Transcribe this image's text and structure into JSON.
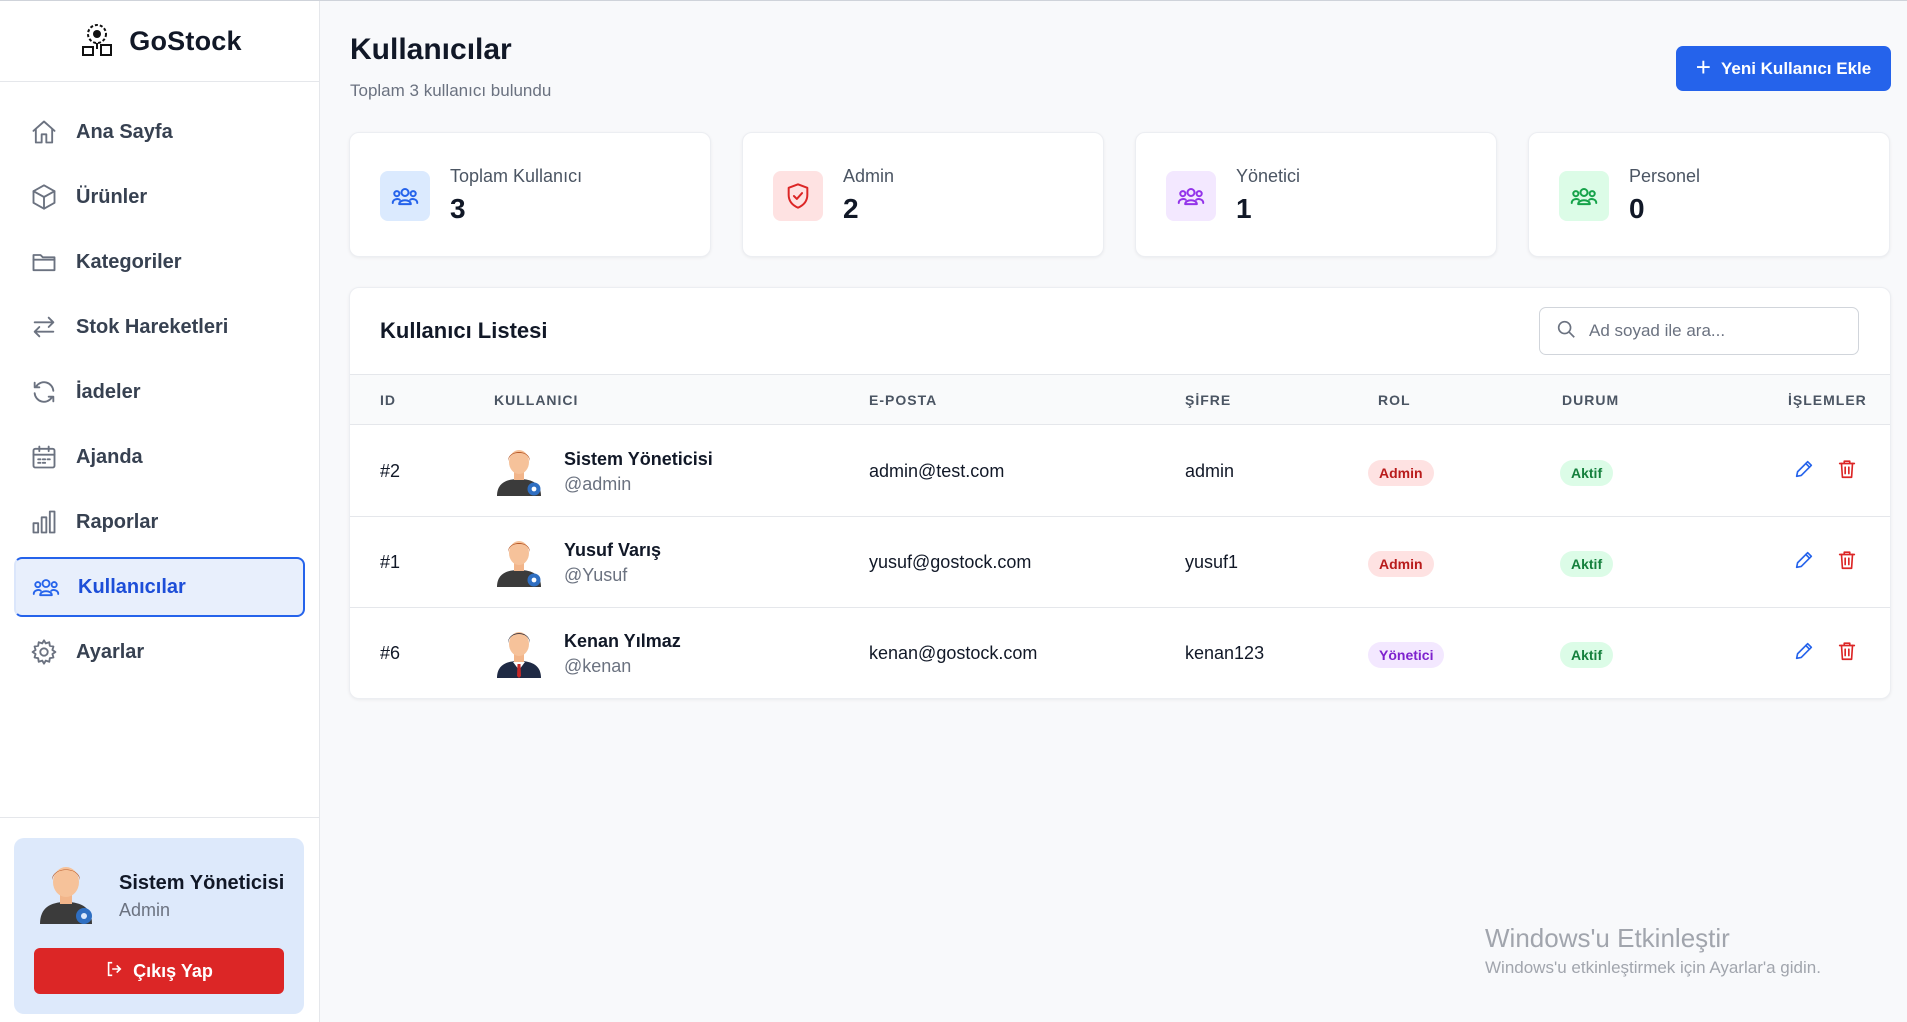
{
  "app": {
    "name": "GoStock"
  },
  "sidebar": {
    "items": [
      {
        "label": "Ana Sayfa",
        "icon": "home-icon",
        "active": false
      },
      {
        "label": "Ürünler",
        "icon": "box-icon",
        "active": false
      },
      {
        "label": "Kategoriler",
        "icon": "folder-icon",
        "active": false
      },
      {
        "label": "Stok Hareketleri",
        "icon": "arrows-icon",
        "active": false
      },
      {
        "label": "İadeler",
        "icon": "refresh-icon",
        "active": false
      },
      {
        "label": "Ajanda",
        "icon": "calendar-icon",
        "active": false
      },
      {
        "label": "Raporlar",
        "icon": "bar-chart-icon",
        "active": false
      },
      {
        "label": "Kullanıcılar",
        "icon": "users-icon",
        "active": true
      },
      {
        "label": "Ayarlar",
        "icon": "gear-icon",
        "active": false
      }
    ],
    "current_user": {
      "name": "Sistem Yöneticisi",
      "role": "Admin"
    },
    "logout_label": "Çıkış Yap"
  },
  "header": {
    "title": "Kullanıcılar",
    "subtitle": "Toplam 3 kullanıcı bulundu",
    "add_button_label": "Yeni Kullanıcı Ekle"
  },
  "stats": [
    {
      "label": "Toplam Kullanıcı",
      "value": "3",
      "icon": "users-icon",
      "color": "#2563eb",
      "bg": "#dbeafe"
    },
    {
      "label": "Admin",
      "value": "2",
      "icon": "shield-check-icon",
      "color": "#dc2626",
      "bg": "#fee2e2"
    },
    {
      "label": "Yönetici",
      "value": "1",
      "icon": "users-icon",
      "color": "#9333ea",
      "bg": "#f3e8ff"
    },
    {
      "label": "Personel",
      "value": "0",
      "icon": "users-icon",
      "color": "#16a34a",
      "bg": "#dcfce7"
    }
  ],
  "user_list": {
    "title": "Kullanıcı Listesi",
    "search_placeholder": "Ad soyad ile ara...",
    "columns": [
      "ID",
      "KULLANICI",
      "E-POSTA",
      "ŞİFRE",
      "ROL",
      "DURUM",
      "İŞLEMLER"
    ],
    "rows": [
      {
        "id": "#2",
        "name": "Sistem Yöneticisi",
        "handle": "@admin",
        "email": "admin@test.com",
        "password": "admin",
        "role": "Admin",
        "status": "Aktif",
        "avatar": "admin-avatar-icon"
      },
      {
        "id": "#1",
        "name": "Yusuf Varış",
        "handle": "@Yusuf",
        "email": "yusuf@gostock.com",
        "password": "yusuf1",
        "role": "Admin",
        "status": "Aktif",
        "avatar": "admin-avatar-icon"
      },
      {
        "id": "#6",
        "name": "Kenan Yılmaz",
        "handle": "@kenan",
        "email": "kenan@gostock.com",
        "password": "kenan123",
        "role": "Yönetici",
        "status": "Aktif",
        "avatar": "manager-avatar-icon"
      }
    ]
  },
  "badge_colors": {
    "Admin": {
      "bg": "#fee2e2",
      "fg": "#b91c1c"
    },
    "Yönetici": {
      "bg": "#f3e8ff",
      "fg": "#7e22ce"
    },
    "Aktif": {
      "bg": "#dcfce7",
      "fg": "#15803d"
    }
  },
  "watermark": {
    "title": "Windows'u Etkinleştir",
    "subtitle": "Windows'u etkinleştirmek için Ayarlar'a gidin."
  }
}
